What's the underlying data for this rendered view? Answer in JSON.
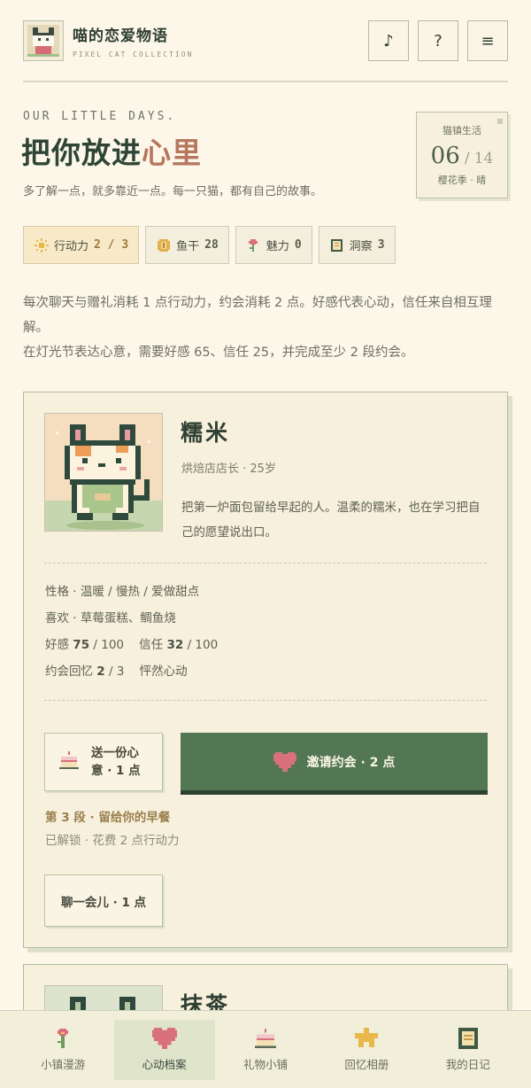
{
  "header": {
    "title": "喵的恋爱物语",
    "subtitle": "PIXEL CAT COLLECTION",
    "music_icon": "♪",
    "help_icon": "?",
    "menu_icon": "≡"
  },
  "hero": {
    "eyebrow": "OUR LITTLE DAYS.",
    "title_main": "把你放进",
    "title_accent": "心里",
    "subtitle": "多了解一点，就多靠近一点。每一只猫，都有自己的故事。"
  },
  "calendar": {
    "label": "猫镇生活",
    "day": "06",
    "separator": "/",
    "total": "14",
    "season": "樱花季 · 晴"
  },
  "stats": [
    {
      "icon": "sun-icon",
      "label": "行动力",
      "value": "2 / 3"
    },
    {
      "icon": "coin-icon",
      "label": "鱼干",
      "value": "28"
    },
    {
      "icon": "flower-icon",
      "label": "魅力",
      "value": "0"
    },
    {
      "icon": "book-icon",
      "label": "洞察",
      "value": "3"
    }
  ],
  "rules": {
    "line1": "每次聊天与赠礼消耗 1 点行动力，约会消耗 2 点。好感代表心动，信任来自相互理解。",
    "line2": "在灯光节表达心意，需要好感 65、信任 25，并完成至少 2 段约会。"
  },
  "card": {
    "name": "糯米",
    "role": "烘焙店店长 · 25岁",
    "desc": "把第一炉面包留给早起的人。温柔的糯米，也在学习把自己的愿望说出口。",
    "personality": "性格 · 温暖 / 慢热 / 爱做甜点",
    "likes": "喜欢 · 草莓蛋糕、鲷鱼烧",
    "affection_label": "好感",
    "affection_value": "75",
    "affection_max": "/ 100",
    "trust_label": "信任",
    "trust_value": "32",
    "trust_max": "/ 100",
    "memory_label": "约会回忆",
    "memory_value": "2",
    "memory_max": "/ 3",
    "mood": "怦然心动",
    "gift_button": "送一份心意 · 1 点",
    "date_button": "邀请约会 · 2 点",
    "memory_title": "第 3 段 · 留给你的早餐",
    "memory_sub": "已解锁 · 花费 2 点行动力",
    "chat_button": "聊一会儿 · 1 点"
  },
  "card2": {
    "name": "抹茶"
  },
  "nav": [
    {
      "label": "小镇漫游",
      "icon": "flower-icon",
      "active": false
    },
    {
      "label": "心动档案",
      "icon": "heart-icon",
      "active": true
    },
    {
      "label": "礼物小铺",
      "icon": "cake-icon",
      "active": false
    },
    {
      "label": "回忆相册",
      "icon": "star-icon",
      "active": false
    },
    {
      "label": "我的日记",
      "icon": "diary-icon",
      "active": false
    }
  ]
}
